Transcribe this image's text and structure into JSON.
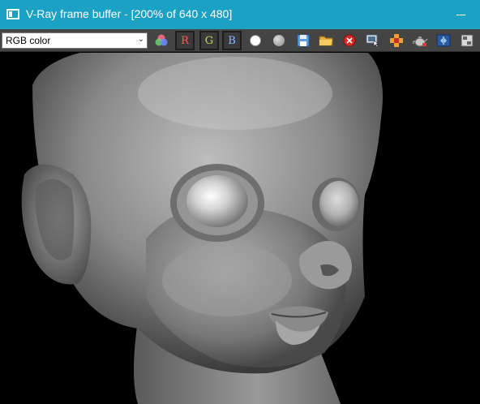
{
  "window": {
    "title": "V-Ray frame buffer - [200% of 640 x 480]"
  },
  "toolbar": {
    "channel": {
      "selected": "RGB color"
    },
    "buttons": [
      {
        "name": "color-picker-icon"
      },
      {
        "name": "red-channel-button",
        "label": "R"
      },
      {
        "name": "green-channel-button",
        "label": "G"
      },
      {
        "name": "blue-channel-button",
        "label": "B"
      },
      {
        "name": "white-dot-icon"
      },
      {
        "name": "grey-dot-icon"
      },
      {
        "name": "save-icon"
      },
      {
        "name": "open-folder-icon"
      },
      {
        "name": "clear-icon"
      },
      {
        "name": "track-mouse-icon"
      },
      {
        "name": "region-render-icon"
      },
      {
        "name": "teapot-render-icon"
      },
      {
        "name": "lens-effects-icon"
      },
      {
        "name": "settings-icon"
      }
    ],
    "colors": {
      "red": "#ff5a5a",
      "green": "#c8d26a",
      "blue": "#8cb4ff"
    }
  },
  "viewport": {
    "content": "rendered-head"
  }
}
